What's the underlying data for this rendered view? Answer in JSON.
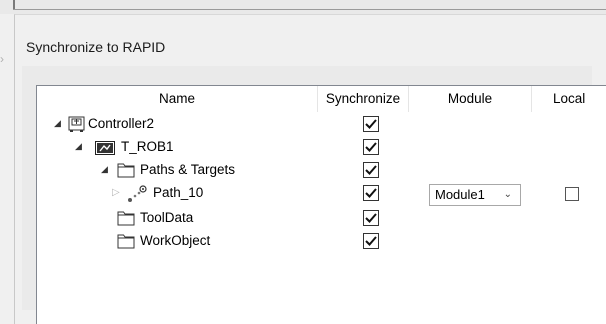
{
  "dialog": {
    "title": "Synchronize to RAPID"
  },
  "columns": {
    "name": "Name",
    "synchronize": "Synchronize",
    "module": "Module",
    "local": "Local"
  },
  "tree": [
    {
      "label": "Controller2",
      "icon": "controller-icon",
      "expanded": true,
      "synchronize": true
    },
    {
      "label": "T_ROB1",
      "icon": "robot-task-icon",
      "expanded": true,
      "synchronize": true
    },
    {
      "label": "Paths & Targets",
      "icon": "folder-icon",
      "expanded": true,
      "synchronize": true
    },
    {
      "label": "Path_10",
      "icon": "path-icon",
      "expanded": false,
      "synchronize": true,
      "module": "Module1",
      "local": false
    },
    {
      "label": "ToolData",
      "icon": "folder-icon",
      "synchronize": true
    },
    {
      "label": "WorkObject",
      "icon": "folder-icon",
      "synchronize": true
    }
  ]
}
